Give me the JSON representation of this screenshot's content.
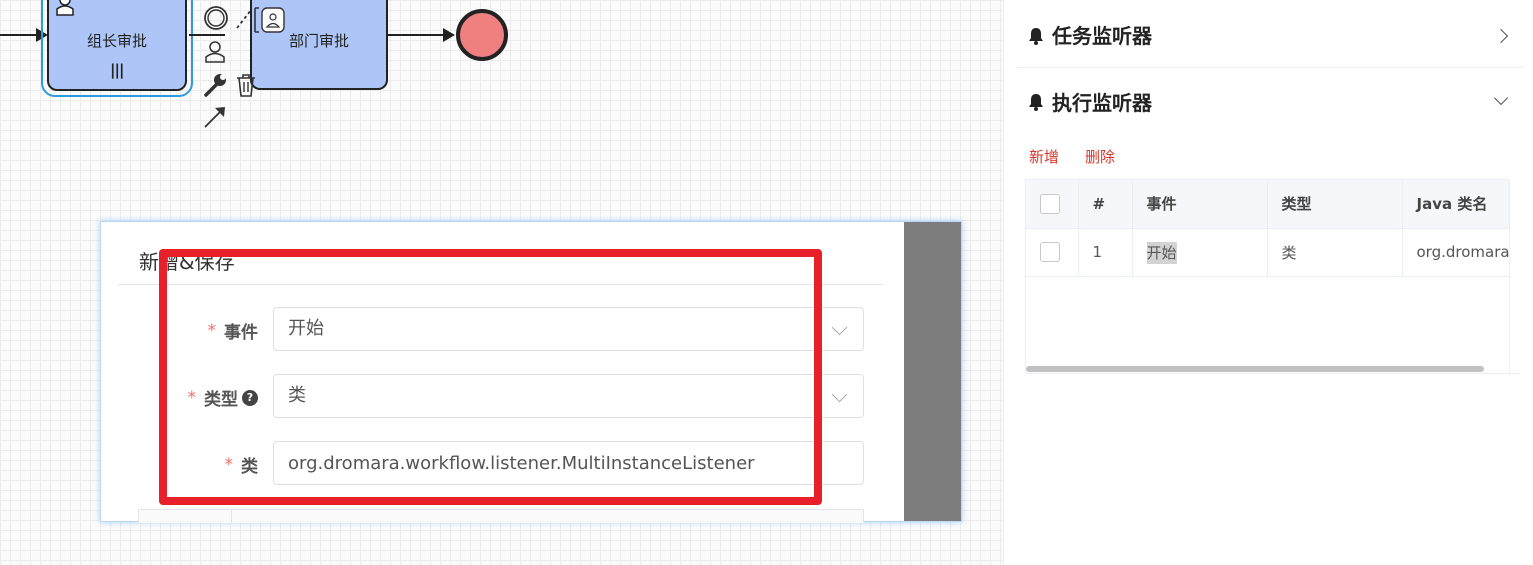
{
  "diagram": {
    "task_group_leader": "组长审批",
    "task_dept": "部门审批",
    "multi_instance_marker": "|||"
  },
  "dialog": {
    "title": "新增&保存",
    "fields": {
      "event": {
        "label": "事件",
        "required_mark": "*",
        "value": "开始"
      },
      "type": {
        "label": "类型",
        "required_mark": "*",
        "value": "类",
        "help": "?"
      },
      "class": {
        "label": "类",
        "required_mark": "*",
        "value": "org.dromara.workflow.listener.MultiInstanceListener"
      }
    }
  },
  "panel": {
    "task_listener": {
      "title": "任务监听器",
      "icon": "bell-icon",
      "expanded": false
    },
    "execution_listener": {
      "title": "执行监听器",
      "icon": "bell-icon",
      "expanded": true
    },
    "actions": {
      "add": "新增",
      "delete": "删除"
    },
    "table": {
      "headers": {
        "index": "#",
        "event": "事件",
        "type": "类型",
        "java_class": "Java 类名"
      },
      "rows": [
        {
          "index": "1",
          "event": "开始",
          "type": "类",
          "java_class": "org.dromara."
        }
      ]
    }
  },
  "colors": {
    "task_fill": "#aec6f7",
    "end_event_fill": "#f08080",
    "selection": "#2f9ae0",
    "highlight_box": "#e8202a",
    "link_red": "#d9362b",
    "required": "#f56c6c"
  }
}
